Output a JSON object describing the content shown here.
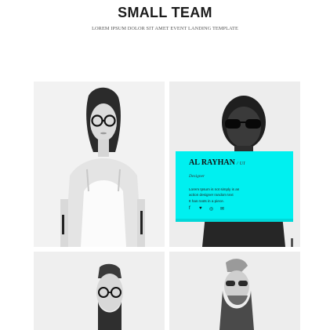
{
  "section": {
    "title": "SMALL TEAM",
    "subtitle": "LOREM IPSUM DOLOR SIT AMET EVENT LANDING TEMPLATE"
  },
  "team_card": {
    "name": "AL RAYHAN",
    "separator": "/",
    "tag": "UI",
    "role": "Designer",
    "description_lines": [
      "Lorem Ipsum is not simply is an",
      "action designer random text",
      "It has roots in a piece."
    ],
    "social_icons": [
      "facebook-icon",
      "twitter-icon",
      "dribbble-icon",
      "email-icon"
    ],
    "accent_color": "#00f0f0"
  }
}
